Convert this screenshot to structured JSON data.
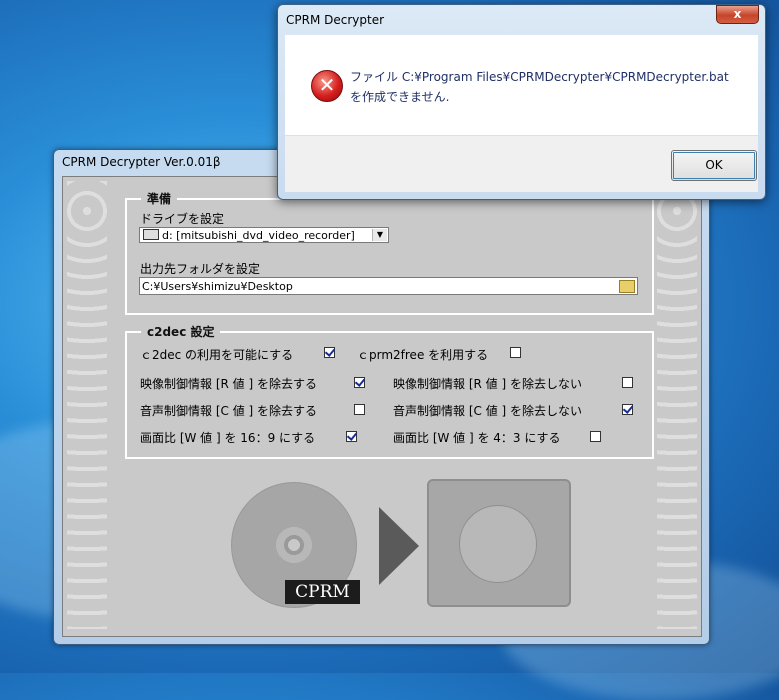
{
  "main_window": {
    "title": "CPRM Decrypter Ver.0.01β",
    "prep_group": {
      "legend": "準備",
      "drive_label": "ドライブを設定",
      "drive_value": "d: [mitsubishi_dvd_video_recorder]",
      "output_label": "出力先フォルダを設定",
      "output_value": "C:¥Users¥shimizu¥Desktop"
    },
    "c2dec_group": {
      "legend": "c2dec 設定",
      "options": [
        {
          "label": "ｃ2dec の利用を可能にする",
          "checked": true
        },
        {
          "label": "ｃprm2free を利用する",
          "checked": false
        },
        {
          "label": "映像制御情報 [R 値 ] を除去する",
          "checked": true
        },
        {
          "label": "映像制御情報 [R 値 ] を除去しない",
          "checked": false
        },
        {
          "label": "音声制御情報 [C 値 ] を除去する",
          "checked": false
        },
        {
          "label": "音声制御情報 [C 値 ] を除去しない",
          "checked": true
        },
        {
          "label": "画面比 [W 値 ] を 16：9 にする",
          "checked": true
        },
        {
          "label": "画面比 [W 値 ] を 4：3 にする",
          "checked": false
        }
      ]
    },
    "graphic": {
      "tag": "CPRM"
    }
  },
  "dialog": {
    "title": "CPRM Decrypter",
    "close_label": "x",
    "icon": "error-icon",
    "message_line1": "ファイル C:¥Program Files¥CPRMDecrypter¥CPRMDecrypter.bat",
    "message_line2": "を作成できません.",
    "ok_label": "OK"
  },
  "colors": {
    "error_red": "#d61e1e",
    "message_text": "#1f3066",
    "checkmark": "#1a2c9a"
  }
}
